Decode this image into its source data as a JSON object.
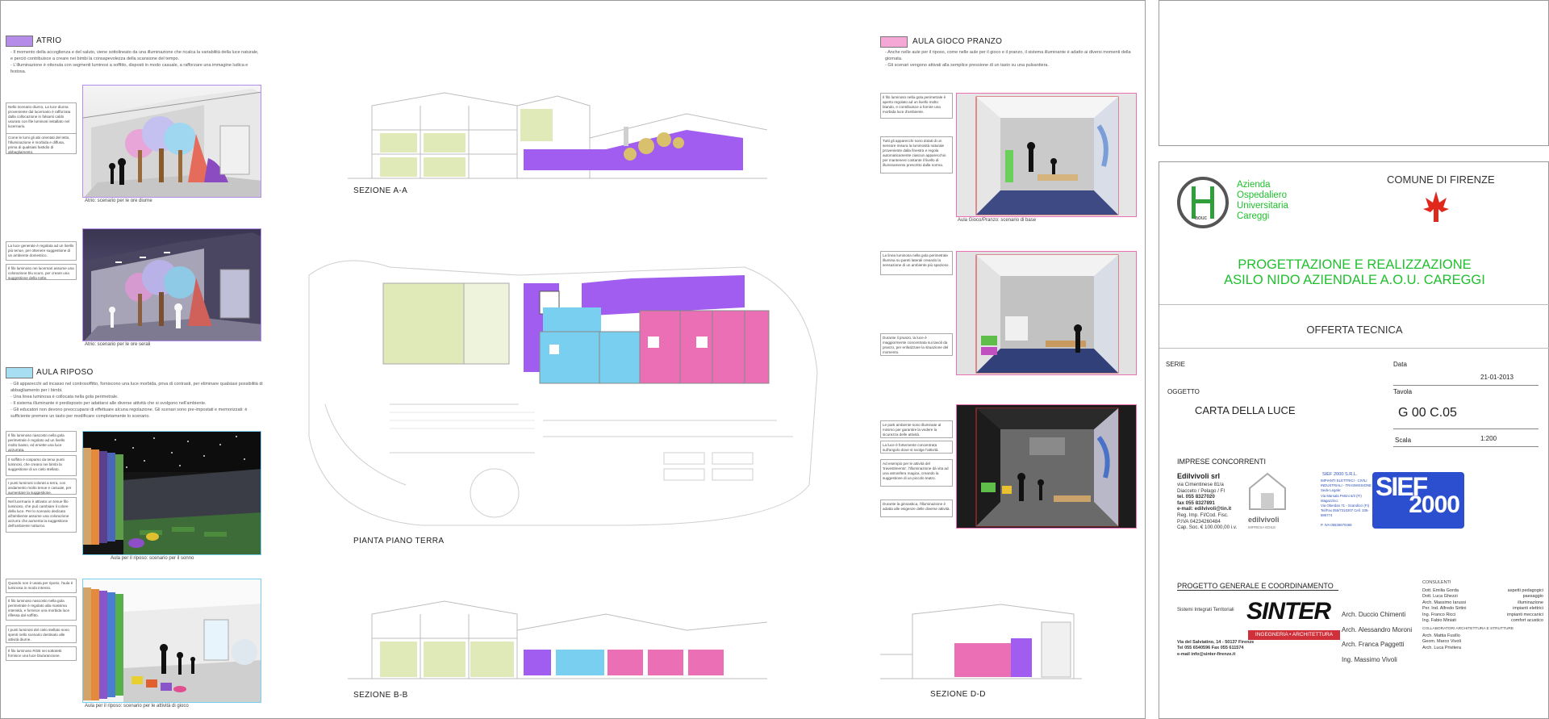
{
  "left": {
    "atrio": {
      "title": "ATRIO",
      "color": "#b58de8",
      "bullets": [
        "Il momento della accoglienza e del saluto, viene sottolineato da una illuminazione che ricalca la variabilità della luce naturale, e perciò contribuisce a creare nei bimbi la consapevolezza della scansione del tempo.",
        "L'illuminazione è ottenuta con segmenti luminosi a soffitto, disposti in modo casuale, a rafforzare una immagine ludica e festosa."
      ],
      "notes_day": [
        "Nello scenario diurno, La luce diurna proveniente dal lucernario è rafforzata dalla collocazione in falsarsi caldo usurato con file luminosi installato nel lucernario.",
        "Come le lumi gli abi orientati del tetto, l'illuminazione è morbida e diffusa, prima di qualsiasi fastidio di abbagliamento."
      ],
      "caption_day": "Atrio: scenario per le ore diurne",
      "notes_evening": [
        "La luce generale è regolata ad un livello più tenue, per ottenere suggestione di un ambiente domestico.",
        "Il filo luminoso nei lucernari assume una colorazione blu scuro, per creare una suggestione della notte."
      ],
      "caption_evening": "Atrio: scenario per le ore serali"
    },
    "riposo": {
      "title": "AULA RIPOSO",
      "color": "#a8def2",
      "bullets": [
        "Gli apparecchi ad incasso nel controsoffitto, forniscono una luce morbida, priva di contrasti, per eliminare qualsiasi possibilità di abbagliamento per i bimbi.",
        "Una linea luminosa è collocata nella gola perimetrale.",
        "Il sistema illuminante è predisposto per adattarsi alle diverse attività che si svolgono nell'ambiente.",
        "Gli educatori non devono preoccuparsi di effettuare alcuna regolazione. Gli scenari sono pre-impostati e memorizzati: è sufficiente premere un tasto per modificare completamente lo scenario."
      ],
      "notes_sleep": [
        "Il filo luminoso nascosto nella gola perimetrale è regolato ad un livello molto basso, ed emette una luce azzurrata.",
        "Il soffitto è cosparso da tenui punti luminosi, che creano nei bimbi la suggestione di un cielo stellato.",
        "I punti luminosi colorati a terra, con andamento molto tenue e casuale, per aumentare la suggestione.",
        "Nel lucernario è attivato un tenue filo luminoso, che può cambiare il colore della luce. Per lo scenario dedicato all'ambiente assume una colorazione azzurra che aumenta la suggestione dell'ambiente notturno."
      ],
      "caption_sleep": "Aula per il riposo: scenario per il sonno",
      "notes_games": [
        "Quando non è usata per riposo, l'aula è luminosa in modo intenso.",
        "Il filo luminoso nascosto nella gola perimetrale è regolato alla massima intensità, e fornisce una morbida luce riflessa dal soffitto.",
        "I punti luminosi del cielo stellato sono spenti nello scenario destinato alle attività diurne.",
        "Il filo luminoso RGB nei sottotetti fornisce una luce blu/arancione."
      ],
      "caption_games": "Aula per il riposo: scenario per le attività di gioco"
    }
  },
  "center": {
    "section_aa": "SEZIONE A-A",
    "plan": "PIANTA PIANO TERRA",
    "section_bb": "SEZIONE B-B",
    "section_dd": "SEZIONE D-D",
    "colors": {
      "green": "#dfeab8",
      "purple": "#a15cf0",
      "blue": "#78cfef",
      "pink": "#ea6fb5"
    }
  },
  "gioco": {
    "title": "AULA GIOCO PRANZO",
    "color": "#f5a8d6",
    "bullets": [
      "Anche nelle aule per il riposo, come nelle aule per il gioco e il pranzo, il sistema illuminante è adatto ai diversi momenti della giornata.",
      "Gli scenari vengono attivati alla semplice pressione di un tasto su una pulsantiera."
    ],
    "notes_1": [
      "Il filo luminoso nella gola perimetrale è aperto regolato ad un livello molto blando, e contribuisce a fornire una morbida luce d'ambiente.",
      "Tutti gli apparecchi sono dotati di un sensore misura la luminosità naturale proveniente dalla finestra e regola automaticamente ciascun apparecchio per mantenere costante il livello di illuminamento prescritto dalla norma."
    ],
    "caption_1": "Aula Gioco/Pranzo: scenario di base",
    "notes_2": [
      "La linea luminosa nella gola perimetrale illumina su pareti laterali creando la sensazione di un ambiente più spazioso.",
      "Durante il pranzo, la luce è maggiormente concentrata sui tavoli da pranzo, per enfatizzare la situazione del momento."
    ],
    "notes_3": [
      "Le parti ambiente sono illuminate al minimo per garantire la vedere la sicurezza delle attività.",
      "La luce è fortemente concentrata sull'angolo dove si svolge l'attività.",
      "Ad esempio per le attività del 'travestimento', l'illuminazione dà vita ad una atmosfera magica, creando la suggestione di un piccolo teatro.",
      "Durante la ginnastica, l'illuminazione è adatta alle esigenze delle diverse attività."
    ]
  },
  "titleblock": {
    "org_lines": [
      "Azienda",
      "Ospedaliero",
      "Universitaria",
      "Careggi"
    ],
    "logo_text": "aouc",
    "comune": "COMUNE DI FIRENZE",
    "project_title_1": "PROGETTAZIONE E REALIZZAZIONE",
    "project_title_2": "ASILO NIDO AZIENDALE A.O.U. CAREGGI",
    "offer": "OFFERTA TECNICA",
    "serie_label": "SERIE",
    "data_label": "Data",
    "data_value": "21-01-2013",
    "oggetto_label": "OGGETTO",
    "oggetto_value": "CARTA DELLA LUCE",
    "tavola_label": "Tavola",
    "tavola_value": "G 00 C.05",
    "scala_label": "Scala",
    "scala_value": "1:200",
    "imprese_label": "IMPRESE CONCORRENTI",
    "edil": {
      "name": "Edilvivoli srl",
      "lines": [
        "via Cimentinese 81/a",
        "Diacceto / Pelago / FI",
        "tel. 055 8327020",
        "fax 055 8327891",
        "e-mail: edilvivoli@tin.it",
        "Reg. Imp. FI/Cod. Fisc.",
        "P.IVA 04234260484",
        "Cap. Soc. € 100.000,00 i.v."
      ],
      "logo": "edilvivoli",
      "logo_sub": "IMPRESA EDILE"
    },
    "sief": {
      "name": "SIEF 2000 S.R.L.",
      "lines": [
        "IMPIANTI ELETTRICI - CIVILI",
        "INDUSTRIALI - TRASMISSIONE",
        "Sede Legale:",
        "Via Marsala Pettini 5/3 (FI)",
        "Magazzino:",
        "Via Oberdan 71 - Scandicci (FI)",
        "Tel/Fax 055/7310207 Cell. 335-586774",
        "P. IVA 05535670469"
      ],
      "logo_1": "SIEF",
      "logo_2": "2000"
    },
    "progetto_label": "PROGETTO GENERALE E COORDINAMENTO",
    "sinter": {
      "left_line": "Sistemi Integrati Territoriali",
      "logo": "SINTER",
      "logo_sub": "INGEGNERIA • ARCHITETTURA",
      "address": [
        "Via del Salviatino, 14 - 50137 Firenze",
        "Tel 055 6540596  Fax 055 611574",
        "e-mail info@sinter-firenze.it"
      ],
      "architects": [
        "Arch. Duccio Chimenti",
        "Arch. Alessandro Moroni",
        "Arch. Franca Paggetti",
        "Ing. Massimo Vivoli"
      ]
    },
    "consulenti_label": "CONSULENTI",
    "consulenti": [
      [
        "Dott. Emilia Gorda",
        "aspetti pedagogici"
      ],
      [
        "Dott. Luca Ghezzi",
        "paesaggio"
      ],
      [
        "Arch. Massimo Iarussi",
        "illuminazione"
      ],
      [
        "Per. Ind. Alfredo Sirtini",
        "impianti elettrici"
      ],
      [
        "Ing. Franco Ricci",
        "impianti meccanici"
      ],
      [
        "Ing. Fabio Miniati",
        "comfort acustico"
      ]
    ],
    "collab_label": "COLLABORATORI ARCHITETTURA E STRUTTURE",
    "collab": [
      "Arch. Mattia Fusillo",
      "Geom. Marco Vivoli",
      "Arch. Luca Privitera"
    ]
  }
}
